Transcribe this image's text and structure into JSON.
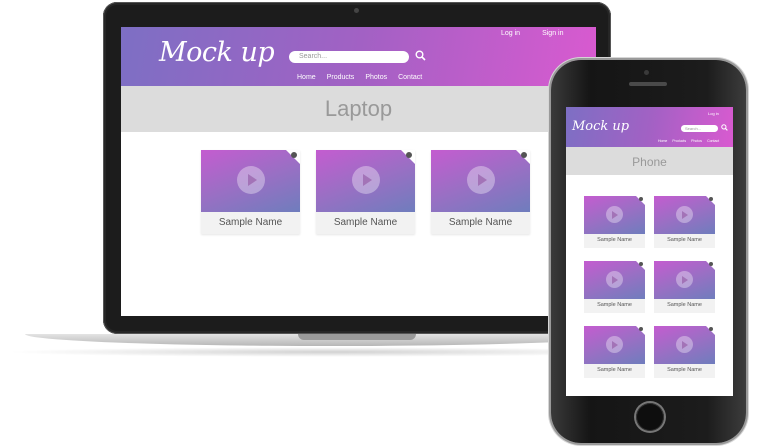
{
  "laptop": {
    "logo": "Mock up",
    "auth": {
      "login": "Log in",
      "signin": "Sign in"
    },
    "search_placeholder": "Search...",
    "nav": [
      "Home",
      "Products",
      "Photos",
      "Contact"
    ],
    "title": "Laptop",
    "cards": [
      "Sample Name",
      "Sample Name",
      "Sample Name"
    ]
  },
  "phone": {
    "logo": "Mock up",
    "login": "Log in",
    "search_placeholder": "Search...",
    "nav": [
      "Home",
      "Products",
      "Photos",
      "Contact"
    ],
    "title": "Phone",
    "cards": [
      "Sample Name",
      "Sample Name",
      "Sample Name",
      "Sample Name",
      "Sample Name",
      "Sample Name"
    ]
  },
  "colors": {
    "gradient_start": "#7d6fc4",
    "gradient_end": "#d95ad0",
    "band": "#dcdcdc"
  }
}
